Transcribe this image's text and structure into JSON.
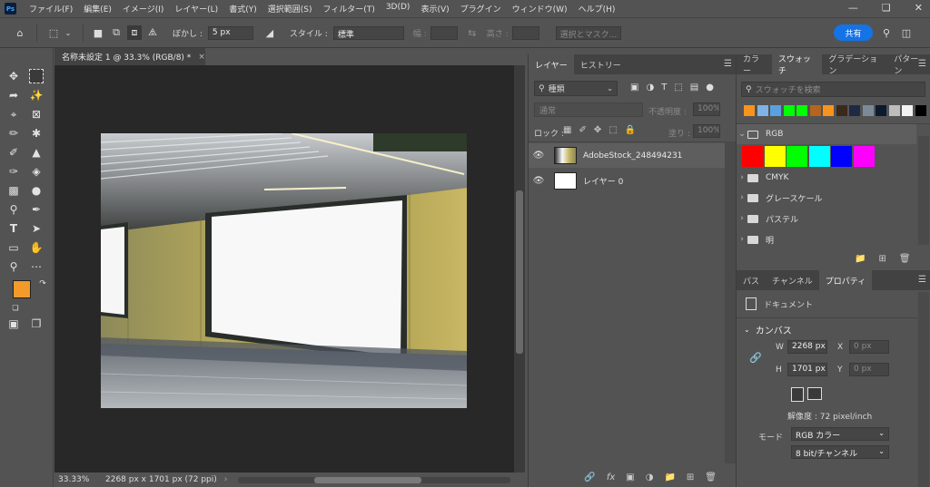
{
  "app": {
    "logo": "Ps"
  },
  "menubar": {
    "items": [
      "ファイル(F)",
      "編集(E)",
      "イメージ(I)",
      "レイヤー(L)",
      "書式(Y)",
      "選択範囲(S)",
      "フィルター(T)",
      "3D(D)",
      "表示(V)",
      "プラグイン",
      "ウィンドウ(W)",
      "ヘルプ(H)"
    ]
  },
  "options": {
    "feather_label": "ぼかし :",
    "feather_value": "5 px",
    "style_label": "スタイル :",
    "style_value": "標準",
    "width_label": "幅 :",
    "height_label": "高さ :",
    "select_mask": "選択とマスク...",
    "share": "共有"
  },
  "document": {
    "tab_title": "名称未設定 1 @ 33.3% (RGB/8) *",
    "zoom": "33.33%",
    "dims": "2268 px x 1701 px (72 ppi)"
  },
  "layers_panel": {
    "tabs": [
      "レイヤー",
      "ヒストリー"
    ],
    "filter_label": "種類",
    "blend_mode": "通常",
    "opacity_label": "不透明度 :",
    "opacity_value": "100%",
    "lock_label": "ロック :",
    "fill_label": "塗り :",
    "fill_value": "100%",
    "layers": [
      {
        "name": "AdobeStock_248494231"
      },
      {
        "name": "レイヤー 0"
      }
    ]
  },
  "swatches_panel": {
    "tabs": [
      "カラー",
      "スウォッチ",
      "グラデーション",
      "パターン"
    ],
    "search_placeholder": "スウォッチを検索",
    "recent_colors": [
      "#f7941d",
      "#7fb2e5",
      "#5aa1e0",
      "#00ff00",
      "#00ff00",
      "#b5651d",
      "#f7941d",
      "#3b2a1a",
      "#1e2a44",
      "#7a8a99",
      "#0b1a2e",
      "#bdbdbd",
      "#f2f2f2",
      "#000000"
    ],
    "groups": [
      {
        "name": "RGB",
        "colors": [
          "#ff0000",
          "#ffff00",
          "#00ff00",
          "#00ffff",
          "#0000ff",
          "#ff00ff"
        ]
      },
      {
        "name": "CMYK"
      },
      {
        "name": "グレースケール"
      },
      {
        "name": "パステル"
      },
      {
        "name": "明"
      }
    ]
  },
  "properties_panel": {
    "tabs": [
      "パス",
      "チャンネル",
      "プロパティ"
    ],
    "doc_label": "ドキュメント",
    "section": "カンバス",
    "w_label": "W",
    "w_value": "2268 px",
    "h_label": "H",
    "h_value": "1701 px",
    "x_label": "X",
    "x_value": "0 px",
    "y_label": "Y",
    "y_value": "0 px",
    "resolution": "解像度 : 72 pixel/inch",
    "mode_label": "モード",
    "mode_value": "RGB カラー",
    "depth_value": "8 bit/チャンネル"
  },
  "colors": {
    "foreground": "#f39b2a",
    "background": "#ffffff",
    "accent": "#1473e6"
  }
}
